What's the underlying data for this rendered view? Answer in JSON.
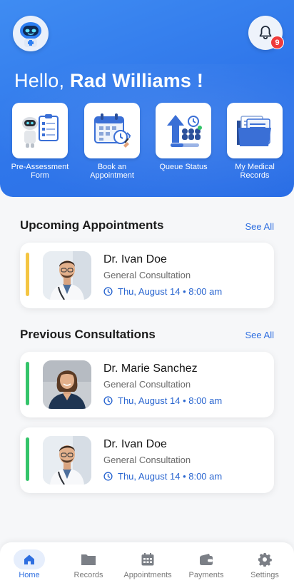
{
  "header": {
    "greeting_prefix": "Hello,",
    "user_name": "Rad Williams !",
    "notification_count": "9"
  },
  "quick_actions": [
    {
      "label": "Pre-Assessment Form",
      "icon": "robot-form-icon"
    },
    {
      "label": "Book an Appointment",
      "icon": "calendar-booking-icon"
    },
    {
      "label": "Queue Status",
      "icon": "queue-status-icon"
    },
    {
      "label": "My Medical Records",
      "icon": "medical-folder-icon"
    }
  ],
  "upcoming": {
    "title": "Upcoming Appointments",
    "see_all": "See All",
    "items": [
      {
        "doctor": "Dr. Ivan Doe",
        "type": "General Consultation",
        "when": "Thu, August 14 • 8:00 am",
        "status_color": "#f4c542"
      }
    ]
  },
  "previous": {
    "title": "Previous Consultations",
    "see_all": "See All",
    "items": [
      {
        "doctor": "Dr. Marie Sanchez",
        "type": "General Consultation",
        "when": "Thu, August 14 • 8:00 am",
        "status_color": "#34c46a"
      },
      {
        "doctor": "Dr. Ivan Doe",
        "type": "General Consultation",
        "when": "Thu, August 14 • 8:00 am",
        "status_color": "#34c46a"
      }
    ]
  },
  "nav": [
    {
      "label": "Home",
      "icon": "home-icon",
      "active": true
    },
    {
      "label": "Records",
      "icon": "folder-icon",
      "active": false
    },
    {
      "label": "Appointments",
      "icon": "calendar-icon",
      "active": false
    },
    {
      "label": "Payments",
      "icon": "wallet-icon",
      "active": false
    },
    {
      "label": "Settings",
      "icon": "gear-icon",
      "active": false
    }
  ],
  "colors": {
    "brand_blue": "#2f76ea",
    "accent_link": "#2f6fe0",
    "upcoming_stripe": "#f4c542",
    "previous_stripe": "#34c46a",
    "badge_red": "#ef3b3b"
  }
}
